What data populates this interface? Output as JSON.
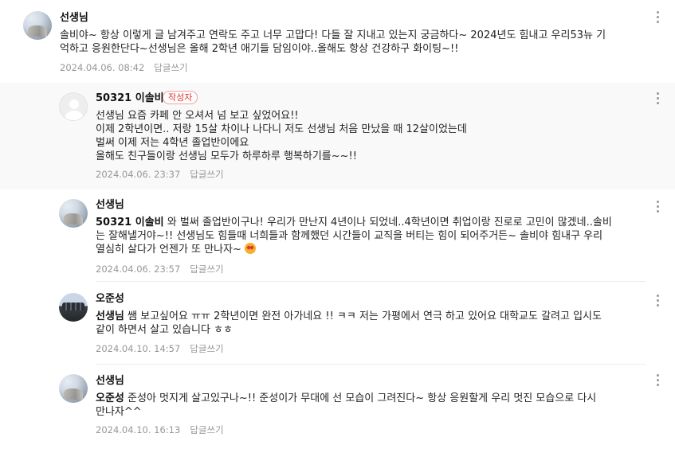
{
  "comments": [
    {
      "nickname": "선생님",
      "mention": "",
      "text": "솔비야~ 항상 이렇게 글 남겨주고 연락도 주고 너무 고맙다! 다들 잘 지내고 있는지 궁금하다~ 2024년도 힘내고 우리53뉴 기\n억하고 응원한단다~선생님은 올해 2학년 애기들 담임이야..올해도 항상 건강하구 화이팅~!!",
      "date": "2024.04.06. 08:42",
      "reply_label": "답글쓰기",
      "avatar": "teacher-photo",
      "badge": ""
    },
    {
      "nickname": "50321 이솔비",
      "mention": "",
      "text": "선생님 요즘 카페 안 오셔서 넘 보고 싶었어요!!\n이제 2학년이면.. 저랑 15살 차이나 나다니 저도 선생님 처음 만났을 때 12살이었는데\n벌써 이제 저는 4학년 졸업반이에요\n올해도 친구들이랑 선생님 모두가 하루하루 행복하기를~~!!",
      "date": "2024.04.06. 23:37",
      "reply_label": "답글쓰기",
      "avatar": "default-profile",
      "badge": "작성자"
    },
    {
      "nickname": "선생님",
      "mention": "50321 이솔비",
      "text": " 와 벌써 졸업반이구나! 우리가 만난지 4년이나 되었네..4학년이면 취업이랑 진로로 고민이 많겠네..솔비\n는 잘해낼거야~!! 선생님도 힘들때 너희들과 함께했던 시간들이 교직을 버티는 힘이 되어주거든~ 솔비야 힘내구 우리\n열심히 살다가 언젠가 또 만나자~",
      "emoji": "star-struck-emoji",
      "date": "2024.04.06. 23:57",
      "reply_label": "답글쓰기",
      "avatar": "teacher-photo",
      "badge": ""
    },
    {
      "nickname": "오준성",
      "mention": "선생님",
      "text": " 쌤 보고싶어요 ㅠㅠ 2학년이면 완전 아가네요 !! ㅋㅋ 저는 가평에서 연극 하고 있어요 대학교도 갈려고 입시도\n같이 하면서 살고 있습니다 ㅎㅎ",
      "date": "2024.04.10. 14:57",
      "reply_label": "답글쓰기",
      "avatar": "group-photo",
      "badge": ""
    },
    {
      "nickname": "선생님",
      "mention": "오준성",
      "text": " 준성아 멋지게 살고있구나~!! 준성이가 무대에 선 모습이 그려진다~ 항상 응원할게 우리 멋진 모습으로 다시\n만나자^^",
      "date": "2024.04.10. 16:13",
      "reply_label": "답글쓰기",
      "avatar": "teacher-photo",
      "badge": ""
    }
  ],
  "more_icon": "more-vertical-icon"
}
